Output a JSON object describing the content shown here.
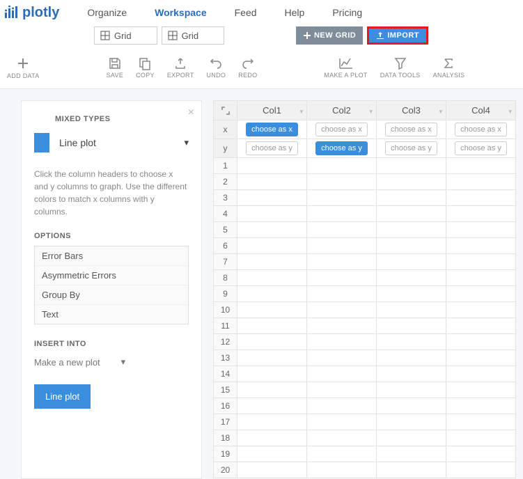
{
  "logo": "plotly",
  "nav": {
    "organize": "Organize",
    "workspace": "Workspace",
    "feed": "Feed",
    "help": "Help",
    "pricing": "Pricing"
  },
  "tabs": {
    "tab1": "Grid",
    "tab2": "Grid"
  },
  "buttons": {
    "newgrid": "NEW GRID",
    "import": "IMPORT"
  },
  "toolbar": {
    "adddata": "ADD DATA",
    "save": "SAVE",
    "copy": "COPY",
    "export": "EXPORT",
    "undo": "UNDO",
    "redo": "REDO",
    "plot": "MAKE A PLOT",
    "datatools": "DATA TOOLS",
    "analysis": "ANALYSIS"
  },
  "panel": {
    "title": "MIXED TYPES",
    "plot_type": "Line plot",
    "help": "Click the column headers to choose x and y columns to graph. Use the different colors to match x columns with y columns.",
    "options_label": "OPTIONS",
    "options": {
      "errorbars": "Error Bars",
      "asym": "Asymmetric Errors",
      "groupby": "Group By",
      "text": "Text"
    },
    "insert_label": "INSERT INTO",
    "insert_value": "Make a new plot",
    "go": "Line plot"
  },
  "grid": {
    "cols": {
      "c1": "Col1",
      "c2": "Col2",
      "c3": "Col3",
      "c4": "Col4"
    },
    "axis_x": "x",
    "axis_y": "y",
    "choose_x": "choose as x",
    "choose_y": "choose as y",
    "rows": {
      "r1": "1",
      "r2": "2",
      "r3": "3",
      "r4": "4",
      "r5": "5",
      "r6": "6",
      "r7": "7",
      "r8": "8",
      "r9": "9",
      "r10": "10",
      "r11": "11",
      "r12": "12",
      "r13": "13",
      "r14": "14",
      "r15": "15",
      "r16": "16",
      "r17": "17",
      "r18": "18",
      "r19": "19",
      "r20": "20"
    }
  }
}
